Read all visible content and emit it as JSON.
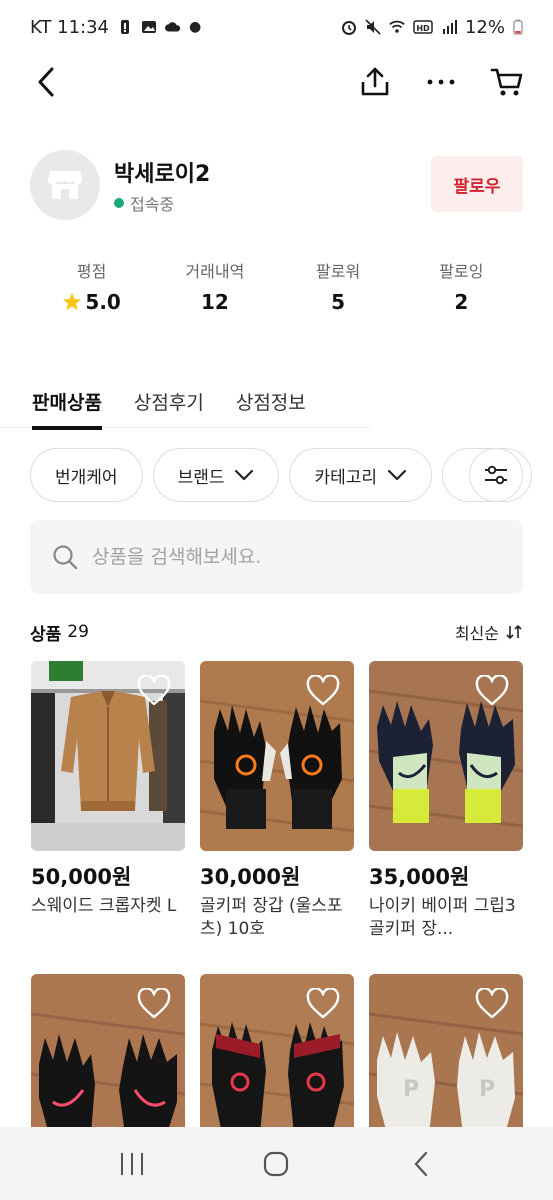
{
  "status_bar": {
    "carrier_time": "KT 11:34",
    "battery": "12%"
  },
  "shop": {
    "name": "박세로이2",
    "online_status": "접속중",
    "follow_label": "팔로우"
  },
  "stats": [
    {
      "label": "평점",
      "value": "5.0"
    },
    {
      "label": "거래내역",
      "value": "12"
    },
    {
      "label": "팔로워",
      "value": "5"
    },
    {
      "label": "팔로잉",
      "value": "2"
    }
  ],
  "tabs": [
    {
      "label": "판매상품",
      "active": true
    },
    {
      "label": "상점후기",
      "active": false
    },
    {
      "label": "상점정보",
      "active": false
    }
  ],
  "chips": [
    {
      "label": "번개케어"
    },
    {
      "label": "브랜드"
    },
    {
      "label": "카테고리"
    }
  ],
  "search": {
    "placeholder": "상품을 검색해보세요."
  },
  "products_header": {
    "label": "상품",
    "count": "29",
    "sort_label": "최신순"
  },
  "products": [
    {
      "price": "50,000원",
      "title": "스웨이드 크롭자켓 L",
      "image": "jacket"
    },
    {
      "price": "30,000원",
      "title": "골키퍼 장갑 (울스포츠) 10호",
      "image": "glove-black-orange"
    },
    {
      "price": "35,000원",
      "title": "나이키 베이퍼 그립3 골키퍼 장...",
      "image": "glove-navy-volt"
    },
    {
      "price": "",
      "title": "",
      "image": "glove-black-pink"
    },
    {
      "price": "",
      "title": "",
      "image": "glove-black-red"
    },
    {
      "price": "",
      "title": "",
      "image": "glove-white"
    }
  ],
  "colors": {
    "accent": "#d3232f",
    "follow_bg": "#fdeeee",
    "online": "#1aa973",
    "star": "#f5c518"
  }
}
